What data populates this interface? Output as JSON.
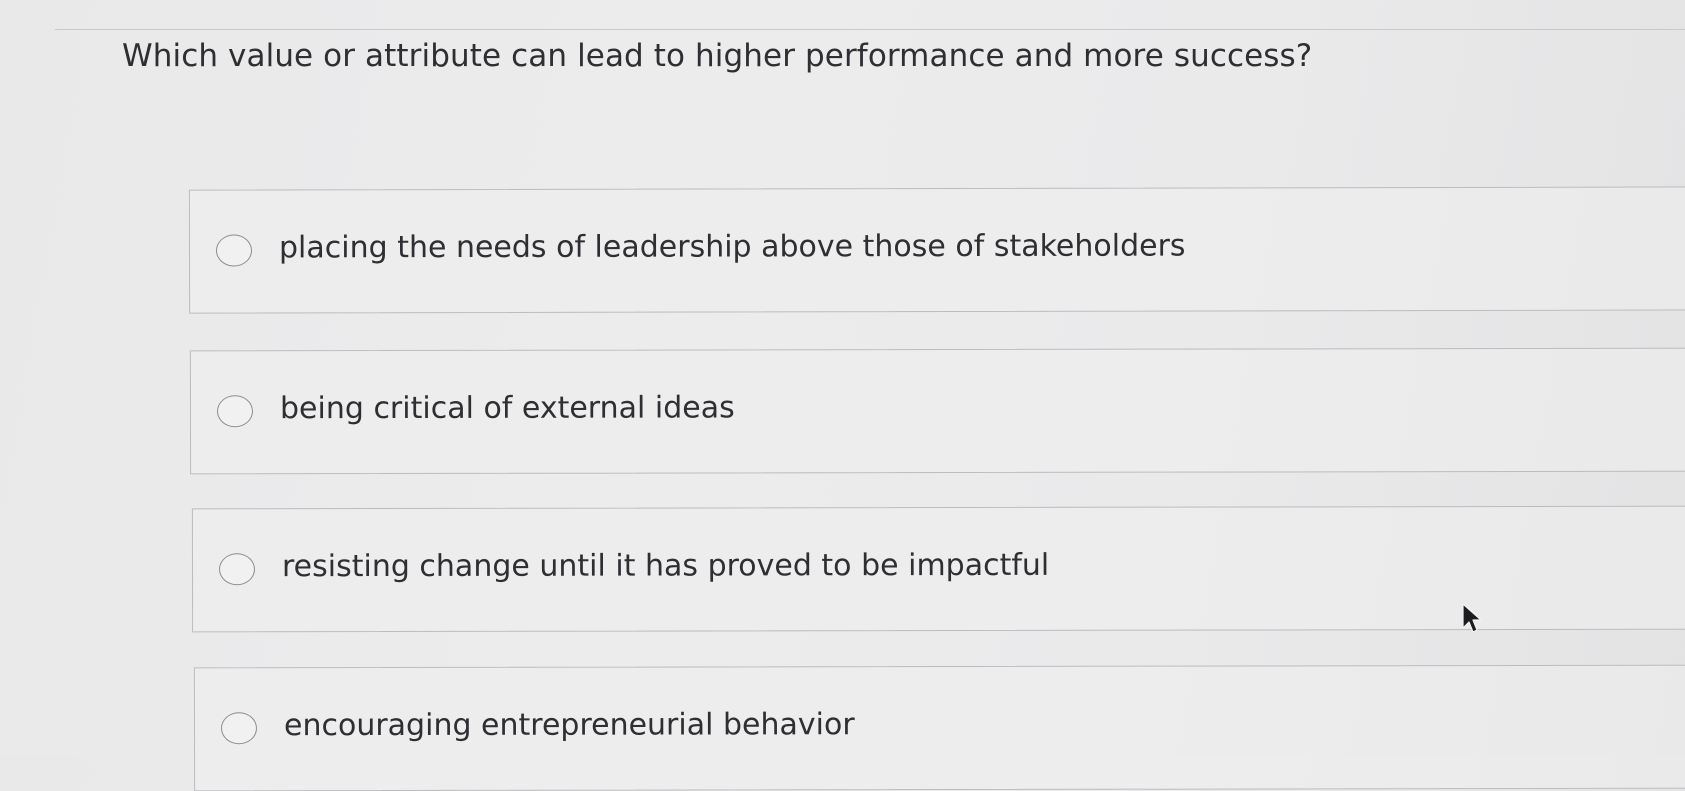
{
  "question": {
    "text": "Which value or attribute can lead to higher performance and more success?"
  },
  "options": [
    {
      "label": "placing the needs of leadership above those of stakeholders",
      "selected": false
    },
    {
      "label": "being critical of external ideas",
      "selected": false
    },
    {
      "label": "resisting change until it has proved to be impactful",
      "selected": false
    },
    {
      "label": "encouraging entrepreneurial behavior",
      "selected": false
    }
  ],
  "icons": {
    "radio": "radio-button-icon",
    "cursor": "mouse-pointer-icon"
  },
  "colors": {
    "text": "#2e2e33",
    "border": "#bcbcbe",
    "radio_border": "#8d8d92",
    "background": "#ebebec"
  }
}
